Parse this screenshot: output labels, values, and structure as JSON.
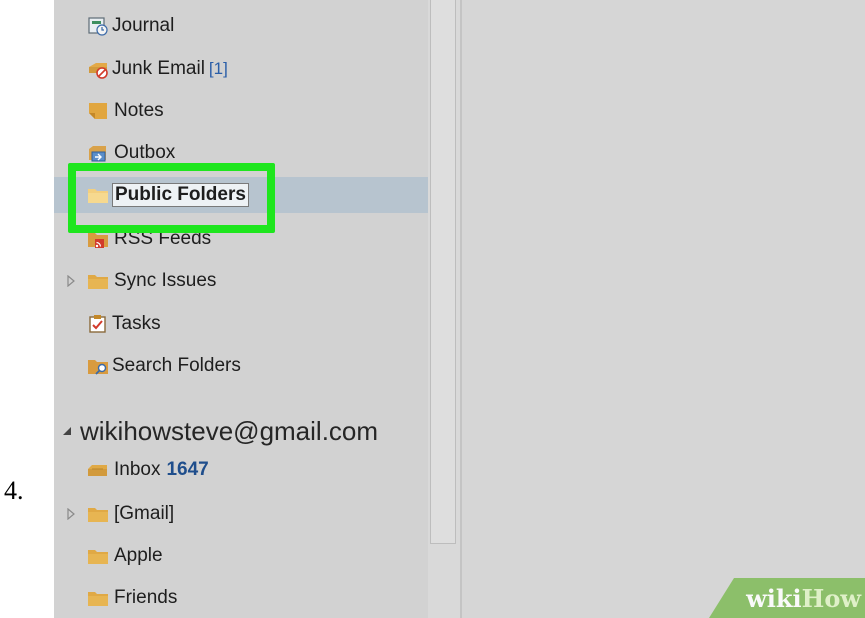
{
  "step": {
    "number": "4."
  },
  "folders": [
    {
      "label": "Journal",
      "icon": "journal-icon"
    },
    {
      "label": "Junk Email",
      "count": "[1]",
      "icon": "junk-email-icon"
    },
    {
      "label": "Notes",
      "icon": "notes-icon"
    },
    {
      "label": "Outbox",
      "icon": "outbox-icon"
    },
    {
      "label": "Public Folders",
      "icon": "folder-icon",
      "selected": true
    },
    {
      "label": "RSS Feeds",
      "icon": "rss-icon"
    },
    {
      "label": "Sync Issues",
      "icon": "folder-icon",
      "expandable": true
    },
    {
      "label": "Tasks",
      "icon": "tasks-icon"
    },
    {
      "label": "Search Folders",
      "icon": "search-folder-icon"
    }
  ],
  "account": {
    "email": "wikihowsteve@gmail.com",
    "expanded": true,
    "folders": [
      {
        "label": "Inbox",
        "count": "1647",
        "icon": "inbox-icon"
      },
      {
        "label": "[Gmail]",
        "icon": "folder-icon",
        "expandable": true
      },
      {
        "label": "Apple",
        "icon": "folder-icon"
      },
      {
        "label": "Friends",
        "icon": "folder-icon"
      }
    ]
  },
  "highlight": {
    "color": "#1ee61e",
    "target": "Public Folders"
  },
  "watermark": {
    "wiki": "wiki",
    "how": "How"
  },
  "colors": {
    "selection": "#b7c4cf",
    "count_accent": "#1f4e8c",
    "folder_yellow": "#e8b84a"
  }
}
